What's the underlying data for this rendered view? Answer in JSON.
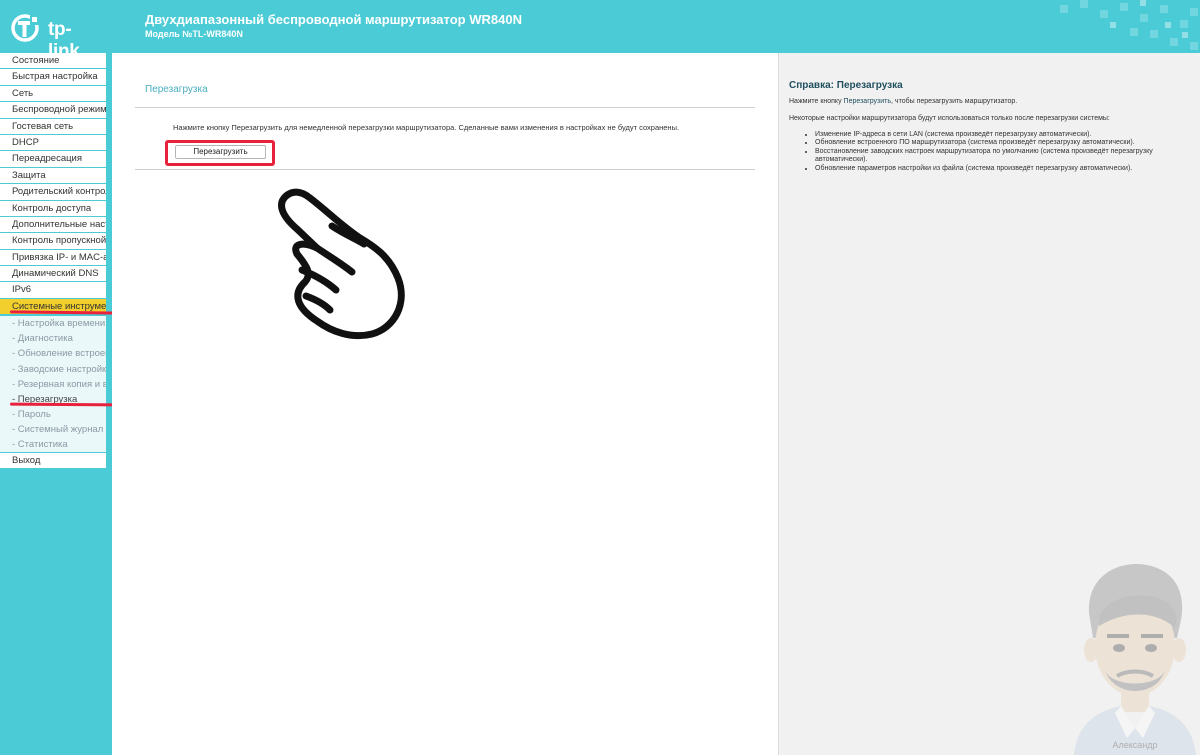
{
  "header": {
    "brand": "tp-link",
    "title": "Двухдиапазонный беспроводной маршрутизатор WR840N",
    "model": "Модель №TL-WR840N"
  },
  "sidebar": {
    "items": [
      {
        "label": "Состояние"
      },
      {
        "label": "Быстрая настройка"
      },
      {
        "label": "Сеть"
      },
      {
        "label": "Беспроводной режим"
      },
      {
        "label": "Гостевая сеть"
      },
      {
        "label": "DHCP"
      },
      {
        "label": "Переадресация"
      },
      {
        "label": "Защита"
      },
      {
        "label": "Родительский контроль"
      },
      {
        "label": "Контроль доступа"
      },
      {
        "label": "Дополнительные настройки маршрутизации"
      },
      {
        "label": "Контроль пропускной способности"
      },
      {
        "label": "Привязка IP- и MAC-адресов"
      },
      {
        "label": "Динамический DNS"
      },
      {
        "label": "IPv6"
      },
      {
        "label": "Системные инструменты"
      }
    ],
    "subitems": [
      {
        "label": "- Настройка времени"
      },
      {
        "label": "- Диагностика"
      },
      {
        "label": "- Обновление встроенного ПО"
      },
      {
        "label": "- Заводские настройки"
      },
      {
        "label": "- Резервная копия и восстановление"
      },
      {
        "label": "- Перезагрузка"
      },
      {
        "label": "- Пароль"
      },
      {
        "label": "- Системный журнал"
      },
      {
        "label": "- Статистика"
      }
    ],
    "logout": "Выход"
  },
  "main": {
    "section_title": "Перезагрузка",
    "instruction": "Нажмите кнопку Перезагрузить для немедленной перезагрузки маршрутизатора. Сделанные вами изменения в настройках не будут сохранены.",
    "reboot_button": "Перезагрузить"
  },
  "help": {
    "title": "Справка: Перезагрузка",
    "p1_prefix": "Нажмите кнопку ",
    "p1_link": "Перезагрузить",
    "p1_suffix": ", чтобы перезагрузить маршрутизатор.",
    "p2": "Некоторые настройки маршрутизатора будут использоваться только после перезагрузки системы:",
    "list": [
      "Изменение IP-адреса в сети LAN (система произведёт перезагрузку автоматически).",
      "Обновление встроенного ПО маршрутизатора (система произведёт перезагрузку автоматически).",
      "Восстановление заводских настроек маршрутизатора по умолчанию (система произведёт перезагрузку автоматически).",
      "Обновление параметров настройки из файла (система произведёт перезагрузку автоматически)."
    ],
    "watermark": "Александр"
  },
  "colors": {
    "accent": "#4acbd6",
    "active": "#f2cf2c",
    "highlight": "#e8213c"
  }
}
